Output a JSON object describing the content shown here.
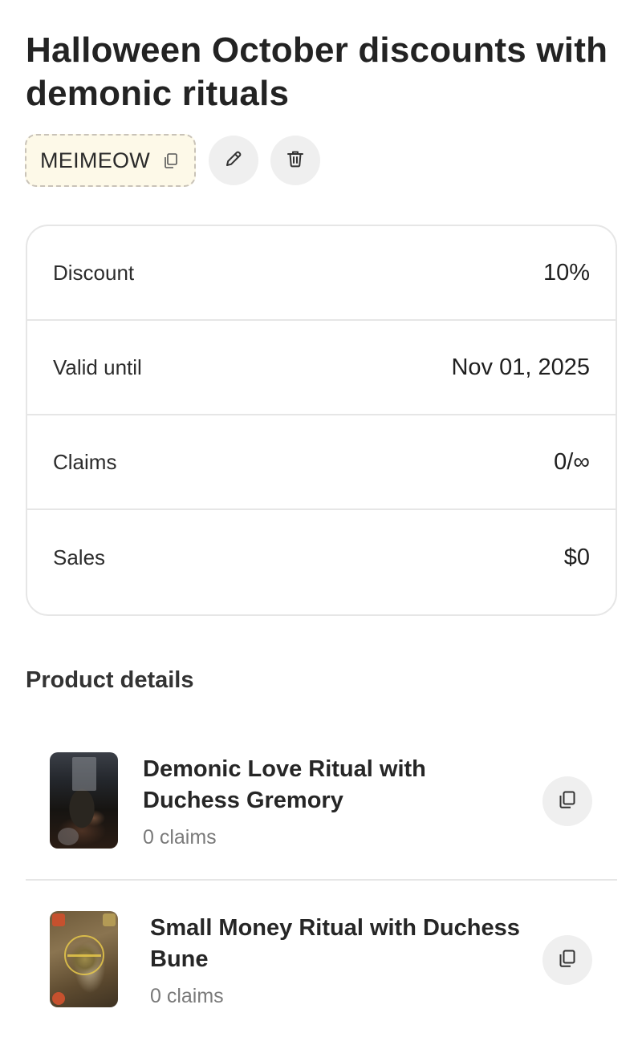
{
  "page": {
    "title": "Halloween October discounts with demonic rituals"
  },
  "code": {
    "value": "MEIMEOW",
    "copy_icon": "copy-icon"
  },
  "actions": {
    "edit_icon": "pencil-icon",
    "delete_icon": "trash-icon"
  },
  "stats": [
    {
      "label": "Discount",
      "value": "10%"
    },
    {
      "label": "Valid until",
      "value": "Nov 01, 2025"
    },
    {
      "label": "Claims",
      "value": "0/∞"
    },
    {
      "label": "Sales",
      "value": "$0"
    }
  ],
  "products_section": {
    "title": "Product details",
    "items": [
      {
        "name": "Demonic Love Ritual with Duchess Gremory",
        "claims": "0 claims"
      },
      {
        "name": "Small Money Ritual with Duchess Bune",
        "claims": "0 claims"
      }
    ]
  },
  "colors": {
    "code_chip_bg": "#fdf9e8",
    "button_bg": "#efefef",
    "border": "#e6e6e6",
    "muted_text": "#7a7a7a"
  }
}
